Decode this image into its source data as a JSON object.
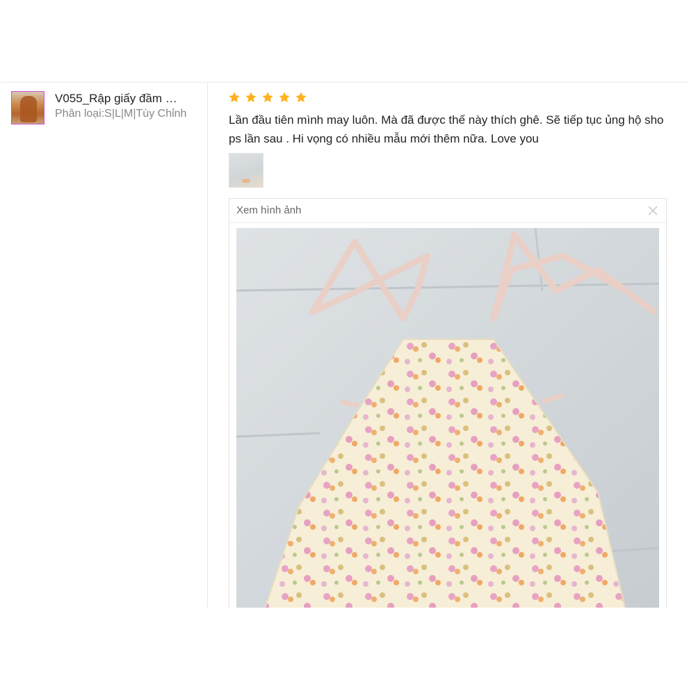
{
  "product": {
    "name": "V055_Rập giấy đầm …",
    "variation": "Phân loại:S|L|M|Tùy Chỉnh"
  },
  "review": {
    "rating": 5,
    "text": "Lần đầu tiên mình may luôn. Mà đã được thế này thích ghê. Sẽ tiếp tục ủng hộ shops lần sau . Hi vọng có nhiều mẫu mới thêm nữa. Love you"
  },
  "viewer": {
    "title": "Xem hình ảnh"
  },
  "icons": {
    "star": "star-icon",
    "close": "close-icon"
  },
  "colors": {
    "star": "#ffb21e",
    "thumb_border": "#c94fc9",
    "text": "#222222",
    "muted": "#888888"
  }
}
